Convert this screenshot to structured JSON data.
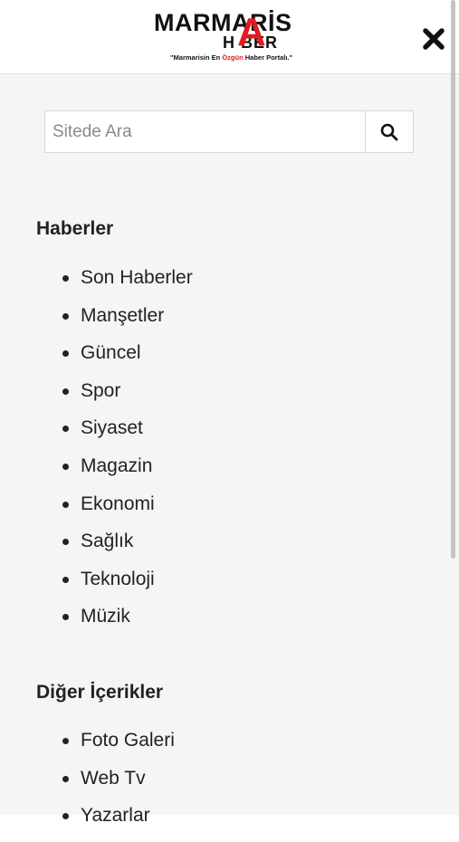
{
  "header": {
    "logo": {
      "line1": "MARMARİS",
      "line2": "H BER",
      "big_letter": "A",
      "slogan_pre": "\"Marmarisin En ",
      "slogan_highlight": "Özgün",
      "slogan_post": " Haber Portalı.\""
    },
    "close_icon": "close-x-icon"
  },
  "search": {
    "placeholder": "Sitede Ara",
    "value": "",
    "icon": "search-icon"
  },
  "sections": [
    {
      "title": "Haberler",
      "items": [
        "Son Haberler",
        "Manşetler",
        "Güncel",
        "Spor",
        "Siyaset",
        "Magazin",
        "Ekonomi",
        "Sağlık",
        "Teknoloji",
        "Müzik"
      ]
    },
    {
      "title": "Diğer İçerikler",
      "items": [
        "Foto Galeri",
        "Web Tv",
        "Yazarlar"
      ]
    }
  ],
  "colors": {
    "accent": "#e01b22",
    "menu_background": "#f5f5f5",
    "text": "#222222"
  }
}
